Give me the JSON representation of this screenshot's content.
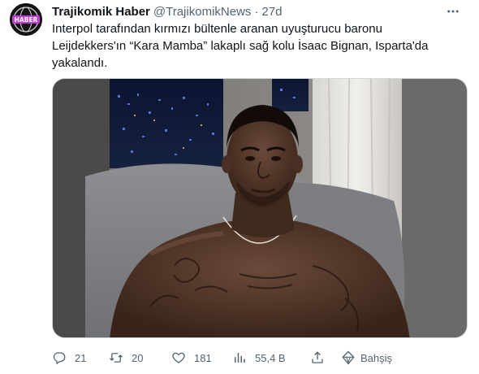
{
  "tweet": {
    "author": {
      "display_name": "Trajikomik Haber",
      "handle": "@TrajikomikNews",
      "separator": "·",
      "time": "27d",
      "avatar_text": "HABER"
    },
    "text": "Interpol tarafından kırmızı bültenle aranan uyuşturucu baronu\nLeijdekkers'ın “Kara Mamba” lakaplı sağ kolu İsaac Bignan, Isparta'da\nyakalandı.",
    "actions": {
      "reply_count": "21",
      "retweet_count": "20",
      "like_count": "181",
      "views_count": "55,4 B",
      "tip_label": "Bahşiş"
    },
    "icons": {
      "more": "more-icon",
      "reply": "reply-icon",
      "retweet": "retweet-icon",
      "like": "heart-icon",
      "views": "views-icon",
      "share": "share-icon",
      "tip": "tip-icon"
    }
  },
  "colors": {
    "text_primary": "#0f1419",
    "text_secondary": "#536471",
    "border": "#cfd9de",
    "avatar_accent": "#c53bd8"
  }
}
